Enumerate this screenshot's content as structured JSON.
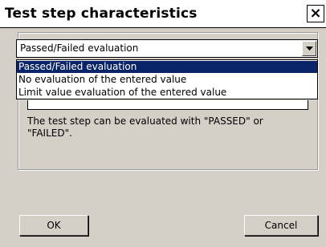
{
  "window": {
    "title": "Test step characteristics",
    "close_glyph": "×"
  },
  "evaluation_select": {
    "selected_value": "Passed/Failed evaluation",
    "options": [
      "Passed/Failed evaluation",
      "No evaluation of the entered value",
      "Limit value evaluation of the entered value"
    ],
    "highlighted_index": 0,
    "arrow_icon": "chevron-down-icon"
  },
  "description": "The test step can be evaluated with \"PASSED\" or \"FAILED\".",
  "buttons": {
    "ok_label": "OK",
    "cancel_label": "Cancel"
  },
  "colors": {
    "selection": "#0a246a",
    "dialog_background": "#d4d0c8"
  }
}
